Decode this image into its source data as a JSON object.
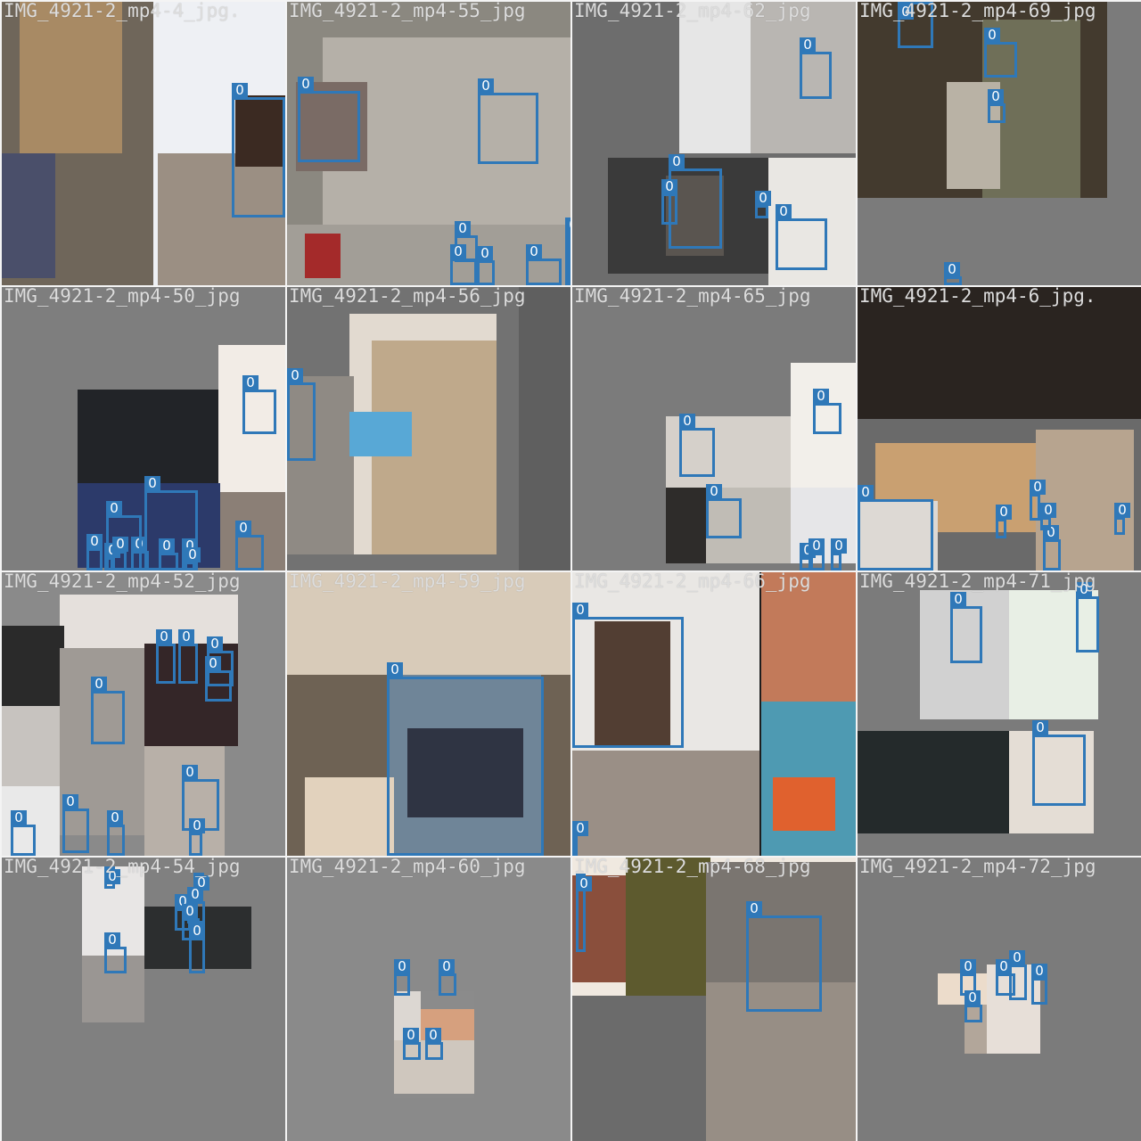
{
  "mosaic": {
    "box_color": "#2f78b8",
    "tiles": [
      {
        "title": "IMG_4921-2_mp4-4_jpg.",
        "boxes": [
          {
            "label": "0"
          }
        ]
      },
      {
        "title": "IMG_4921-2_mp4-55_jpg",
        "boxes": [
          {
            "label": "0"
          },
          {
            "label": "0"
          },
          {
            "label": "0"
          },
          {
            "label": "0"
          },
          {
            "label": "0"
          },
          {
            "label": "0"
          },
          {
            "label": "0"
          }
        ]
      },
      {
        "title": "IMG_4921-2_mp4-62_jpg",
        "boxes": [
          {
            "label": "0"
          },
          {
            "label": "0"
          },
          {
            "label": "0"
          },
          {
            "label": "0"
          },
          {
            "label": "0"
          }
        ]
      },
      {
        "title": "IMG_4921-2_mp4-69_jpg",
        "boxes": [
          {
            "label": "0"
          },
          {
            "label": "0"
          },
          {
            "label": "0"
          },
          {
            "label": "0"
          }
        ]
      },
      {
        "title": "IMG_4921-2_mp4-50_jpg",
        "boxes": [
          {
            "label": "0"
          },
          {
            "label": "0"
          },
          {
            "label": "0"
          },
          {
            "label": "0"
          },
          {
            "label": "0"
          },
          {
            "label": "0"
          },
          {
            "label": "0"
          },
          {
            "label": "0"
          },
          {
            "label": "0"
          },
          {
            "label": "0"
          },
          {
            "label": "0"
          }
        ]
      },
      {
        "title": "IMG_4921-2_mp4-56_jpg",
        "boxes": [
          {
            "label": "0"
          }
        ]
      },
      {
        "title": "IMG_4921-2_mp4-65_jpg",
        "boxes": [
          {
            "label": "0"
          },
          {
            "label": "0"
          },
          {
            "label": "0"
          },
          {
            "label": "0"
          },
          {
            "label": "0"
          },
          {
            "label": "0"
          }
        ]
      },
      {
        "title": "IMG_4921-2_mp4-6_jpg.",
        "boxes": [
          {
            "label": "0"
          },
          {
            "label": "0"
          },
          {
            "label": "0"
          },
          {
            "label": "0"
          },
          {
            "label": "0"
          },
          {
            "label": "0"
          }
        ]
      },
      {
        "title": "IMG_4921-2_mp4-52_jpg",
        "boxes": [
          {
            "label": "0"
          },
          {
            "label": "0"
          },
          {
            "label": "0"
          },
          {
            "label": "0"
          },
          {
            "label": "0"
          },
          {
            "label": "0"
          },
          {
            "label": "0"
          },
          {
            "label": "0"
          },
          {
            "label": "0"
          },
          {
            "label": "0"
          }
        ]
      },
      {
        "title": "IMG_4921-2_mp4-59_jpg",
        "boxes": [
          {
            "label": "0"
          }
        ]
      },
      {
        "title": "IMG_4921-2_mp4-66_jpg",
        "boxes": [
          {
            "label": "0"
          },
          {
            "label": "0"
          }
        ]
      },
      {
        "title": "IMG_4921-2_mp4-71_jpg",
        "boxes": [
          {
            "label": "0"
          },
          {
            "label": "0"
          },
          {
            "label": "0"
          }
        ]
      },
      {
        "title": "IMG_4921-2_mp4-54_jpg",
        "boxes": [
          {
            "label": "0"
          },
          {
            "label": "0"
          },
          {
            "label": "0"
          },
          {
            "label": "0"
          },
          {
            "label": "0"
          },
          {
            "label": "0"
          },
          {
            "label": "0"
          }
        ]
      },
      {
        "title": "IMG_4921-2_mp4-60_jpg",
        "boxes": [
          {
            "label": "0"
          },
          {
            "label": "0"
          },
          {
            "label": "0"
          },
          {
            "label": "0"
          }
        ]
      },
      {
        "title": "IMG_4921-2_mp4-68_jpg",
        "boxes": [
          {
            "label": "0"
          },
          {
            "label": "0"
          }
        ]
      },
      {
        "title": "IMG_4921-2_mp4-72_jpg",
        "boxes": [
          {
            "label": "0"
          },
          {
            "label": "0"
          },
          {
            "label": "0"
          },
          {
            "label": "0"
          },
          {
            "label": "0"
          }
        ]
      }
    ]
  }
}
